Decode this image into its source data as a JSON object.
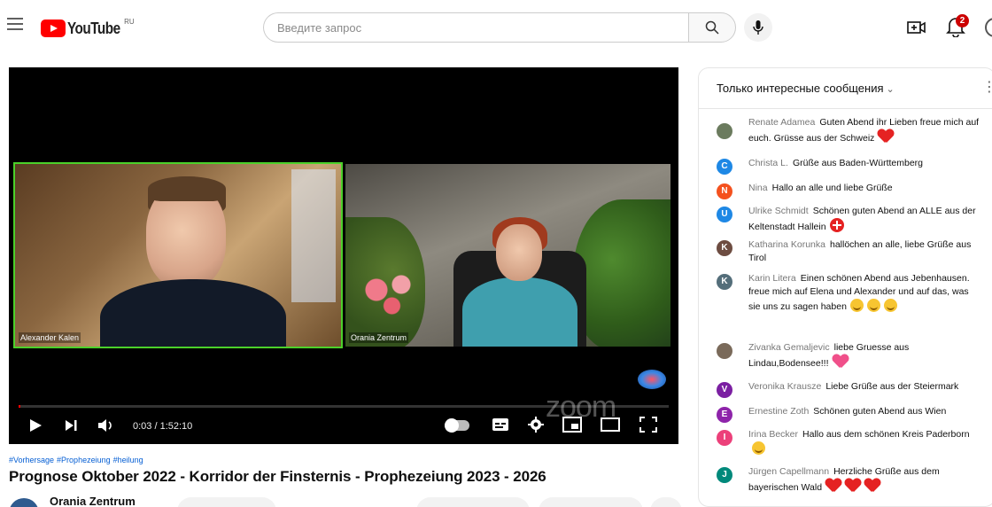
{
  "header": {
    "logo_text": "YouTube",
    "region": "RU",
    "search_placeholder": "Введите запрос",
    "notifications_count": "2"
  },
  "player": {
    "participants": [
      {
        "name": "Alexander Kalen",
        "active_speaker": true
      },
      {
        "name": "Orania Zentrum",
        "active_speaker": false
      }
    ],
    "watermark": "zoom",
    "time_current": "0:03",
    "time_total": "1:52:10",
    "time_display": "0:03 / 1:52:10",
    "progress_fraction": 0.0005
  },
  "video": {
    "hashtags": [
      "#Vorhersage",
      "#Prophezeiung",
      "#heilung"
    ],
    "title": "Prognose Oktober 2022 - Korridor der Finsternis - Prophezeiung 2023 - 2026",
    "channel_name": "Orania Zentrum"
  },
  "chat": {
    "mode_label": "Только интересные сообщения",
    "messages": [
      {
        "author": "Renate Adamea",
        "text": "Guten Abend ihr Lieben freue mich auf euch. Grüsse aus der Schweiz",
        "emoji": "heart",
        "avatar_color": "#6b7b5e",
        "initial": ""
      },
      {
        "author": "Christa L.",
        "text": "Grüße aus Baden-Württemberg",
        "emoji": "",
        "avatar_color": "#1e88e5",
        "initial": "C"
      },
      {
        "author": "Nina",
        "text": "Hallo an alle und liebe Grüße",
        "emoji": "",
        "avatar_color": "#f4511e",
        "initial": "N"
      },
      {
        "author": "Ulrike Schmidt",
        "text": "Schönen guten Abend an ALLE aus der Keltenstadt Hallein",
        "emoji": "swiss",
        "avatar_color": "#1e88e5",
        "initial": "U"
      },
      {
        "author": "Katharina Korunka",
        "text": "hallöchen an alle, liebe Grüße aus Tirol",
        "emoji": "",
        "avatar_color": "#6d4c41",
        "initial": "K"
      },
      {
        "author": "Karin Litera",
        "text": "Einen schönen Abend aus Jebenhausen. freue mich auf Elena und Alexander und auf das, was sie uns zu sagen haben",
        "emoji": "smiles",
        "avatar_color": "#546e7a",
        "initial": "K"
      },
      {
        "author": "Zivanka Gemaljevic",
        "text": "liebe Gruesse aus Lindau,Bodensee!!!",
        "emoji": "pinkheart",
        "avatar_color": "#7a6a5a",
        "initial": ""
      },
      {
        "author": "Veronika Krausze",
        "text": "Liebe Grüße aus der Steiermark",
        "emoji": "",
        "avatar_color": "#7b1fa2",
        "initial": "V"
      },
      {
        "author": "Ernestine Zoth",
        "text": "Schönen guten Abend aus Wien",
        "emoji": "",
        "avatar_color": "#8e24aa",
        "initial": "E"
      },
      {
        "author": "Irina Becker",
        "text": "Hallo aus dem schönen Kreis Paderborn",
        "emoji": "smile",
        "avatar_color": "#ec407a",
        "initial": "I"
      },
      {
        "author": "Jürgen Capellmann",
        "text": "Herzliche Grüße aus dem bayerischen Wald",
        "emoji": "hearts3",
        "avatar_color": "#00897b",
        "initial": "J"
      }
    ]
  },
  "colors": {
    "brand_red": "#ff0000",
    "link_blue": "#065fd4",
    "active_speaker_border": "#4bd12a"
  }
}
